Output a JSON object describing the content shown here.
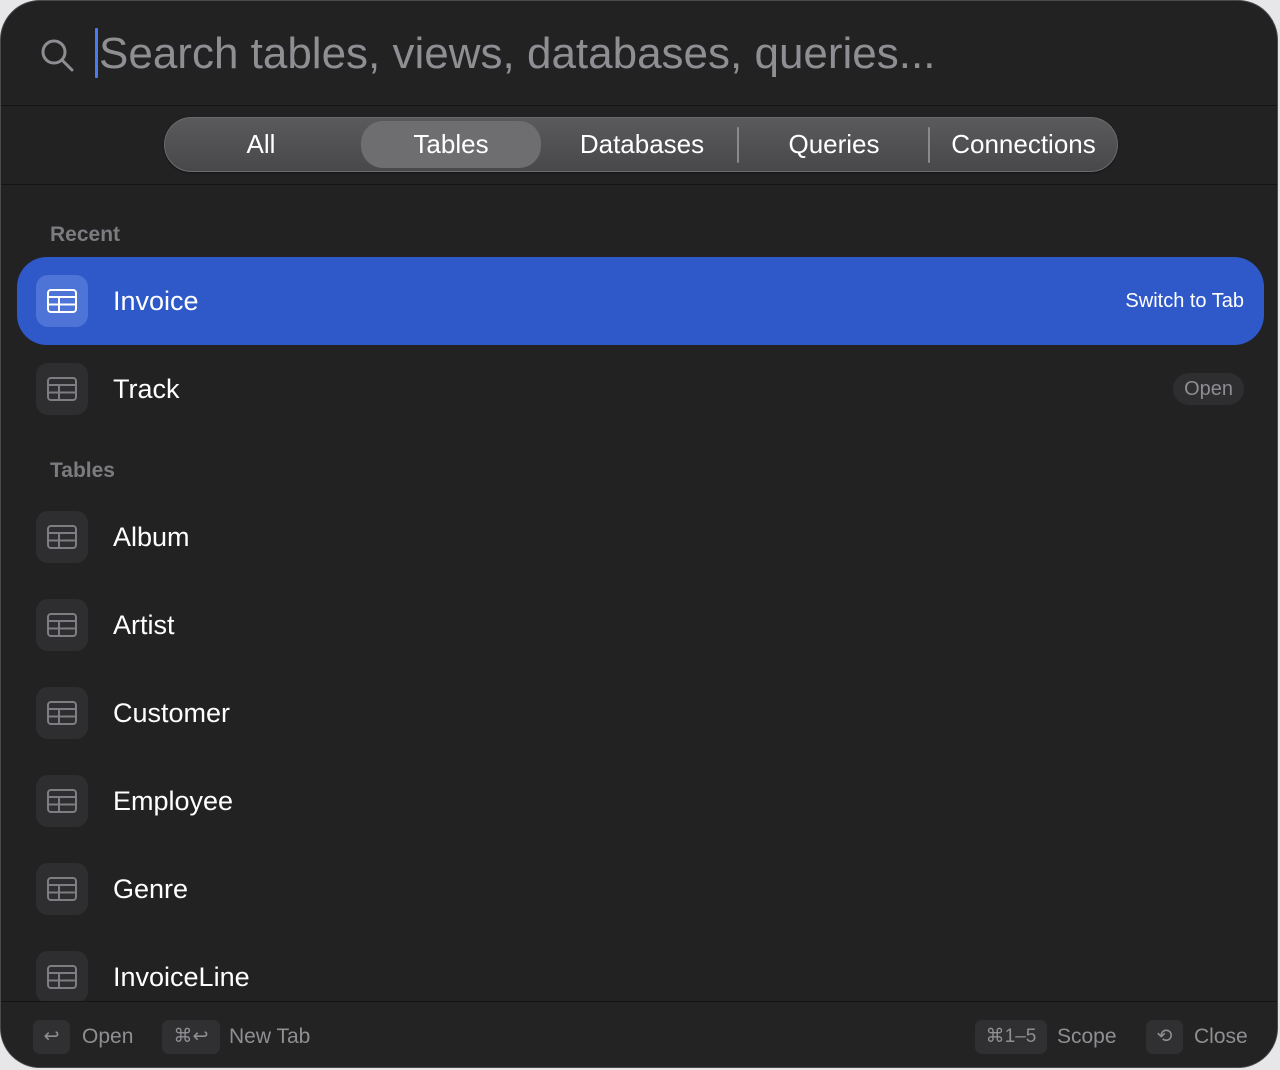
{
  "search": {
    "placeholder": "Search tables, views, databases, queries..."
  },
  "scope": {
    "segments": [
      "All",
      "Tables",
      "Databases",
      "Queries",
      "Connections"
    ],
    "active": "Tables"
  },
  "sections": {
    "recent": {
      "title": "Recent",
      "items": [
        {
          "label": "Invoice",
          "badge": "Switch to Tab",
          "selected": true
        },
        {
          "label": "Track",
          "badge": "Open",
          "selected": false
        }
      ]
    },
    "tables": {
      "title": "Tables",
      "items": [
        {
          "label": "Album"
        },
        {
          "label": "Artist"
        },
        {
          "label": "Customer"
        },
        {
          "label": "Employee"
        },
        {
          "label": "Genre"
        },
        {
          "label": "InvoiceLine"
        }
      ]
    }
  },
  "footer": {
    "open": {
      "key": "↩",
      "label": "Open"
    },
    "new_tab": {
      "key": "⌘↩",
      "label": "New Tab"
    },
    "scope": {
      "key": "⌘1–5",
      "label": "Scope"
    },
    "close": {
      "key": "⟲",
      "label": "Close"
    }
  },
  "colors": {
    "background": "#222223",
    "selection": "#2f58c9",
    "caret": "#4b7bf2",
    "muted_text": "#8f8f93"
  },
  "icons": {
    "search": "search-icon",
    "row": "table-grid-icon",
    "close": "history-icon"
  }
}
